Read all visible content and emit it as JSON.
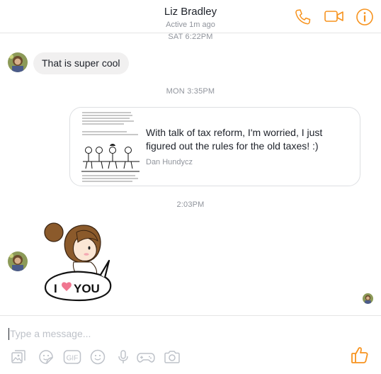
{
  "header": {
    "contact_name": "Liz Bradley",
    "status": "Active 1m ago",
    "icons": [
      "phone-icon",
      "video-camera-icon",
      "info-icon"
    ],
    "accent_color": "#f7931e"
  },
  "conversation": {
    "timestamps": {
      "sat": "SAT 6:22PM",
      "mon": "MON 3:35PM",
      "later": "2:03PM"
    },
    "messages": [
      {
        "type": "text",
        "from": "contact",
        "text": "That is super cool"
      },
      {
        "type": "link_share",
        "from": "contact",
        "title": "With talk of tax reform, I'm worried, I just figured out the rules for the old taxes! :)",
        "author": "Dan Hundycz"
      },
      {
        "type": "sticker",
        "from": "contact",
        "text_left": "I",
        "text_right": "YOU",
        "icon": "heart-icon"
      }
    ]
  },
  "composer": {
    "placeholder": "Type a message...",
    "gif_label": "GIF",
    "tools": [
      "image-icon",
      "sticker-icon",
      "gif-icon",
      "emoji-icon",
      "microphone-icon",
      "game-controller-icon",
      "camera-icon",
      "thumbs-up-icon"
    ]
  }
}
